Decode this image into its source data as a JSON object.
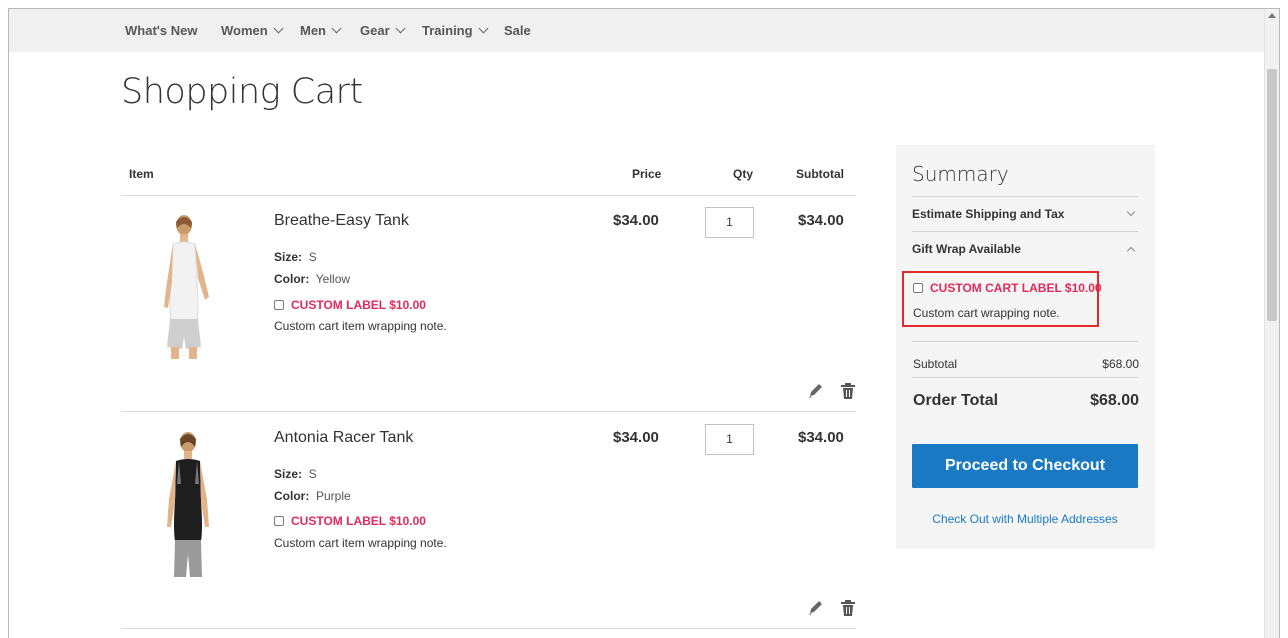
{
  "nav": {
    "items": [
      {
        "label": "What's New",
        "has_dropdown": false
      },
      {
        "label": "Women",
        "has_dropdown": true
      },
      {
        "label": "Men",
        "has_dropdown": true
      },
      {
        "label": "Gear",
        "has_dropdown": true
      },
      {
        "label": "Training",
        "has_dropdown": true
      },
      {
        "label": "Sale",
        "has_dropdown": false
      }
    ]
  },
  "page": {
    "title": "Shopping Cart"
  },
  "cart": {
    "headers": {
      "item": "Item",
      "price": "Price",
      "qty": "Qty",
      "subtotal": "Subtotal"
    },
    "items": [
      {
        "name": "Breathe-Easy Tank",
        "size_label": "Size:",
        "size": "S",
        "color_label": "Color:",
        "color": "Yellow",
        "custom_label": "CUSTOM LABEL $10.00",
        "note": "Custom cart item wrapping note.",
        "price": "$34.00",
        "qty": "1",
        "subtotal": "$34.00",
        "image_icon": "tank-top-white-icon"
      },
      {
        "name": "Antonia Racer Tank",
        "size_label": "Size:",
        "size": "S",
        "color_label": "Color:",
        "color": "Purple",
        "custom_label": "CUSTOM LABEL $10.00",
        "note": "Custom cart item wrapping note.",
        "price": "$34.00",
        "qty": "1",
        "subtotal": "$34.00",
        "image_icon": "tank-top-black-icon"
      }
    ]
  },
  "summary": {
    "title": "Summary",
    "estimate_shipping": "Estimate Shipping and Tax",
    "gift_wrap": "Gift Wrap Available",
    "gift_wrap_label": "CUSTOM CART LABEL $10.00",
    "gift_wrap_note": "Custom cart wrapping note.",
    "subtotal_label": "Subtotal",
    "subtotal_value": "$68.00",
    "order_total_label": "Order Total",
    "order_total_value": "$68.00",
    "checkout_button": "Proceed to Checkout",
    "multi_address_link": "Check Out with Multiple Addresses"
  },
  "colors": {
    "accent_blue": "#1979c3",
    "label_pink": "#e02b5a",
    "highlight_red": "#e02b2b",
    "nav_bg": "#f0f0f0",
    "summary_bg": "#f5f5f5"
  }
}
